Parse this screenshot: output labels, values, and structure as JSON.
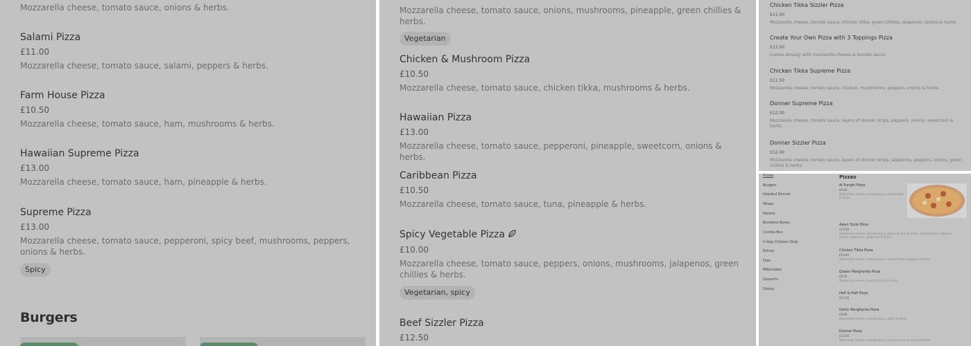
{
  "panel1": {
    "top_desc": "Mozzarella cheese, tomato sauce, onions & herbs.",
    "items": [
      {
        "name": "Salami Pizza",
        "price": "£11.00",
        "desc": "Mozzarella cheese, tomato sauce, salami, peppers & herbs."
      },
      {
        "name": "Farm House Pizza",
        "price": "£10.50",
        "desc": "Mozzarella cheese, tomato sauce, ham, mushrooms & herbs."
      },
      {
        "name": "Hawaiian Supreme Pizza",
        "price": "£13.00",
        "desc": "Mozzarella cheese, tomato sauce, ham, pineapple & herbs."
      },
      {
        "name": "Supreme Pizza",
        "price": "£13.00",
        "desc": "Mozzarella cheese, tomato sauce, pepperoni, spicy beef, mushrooms, peppers, onions & herbs.",
        "tag": "Spicy"
      }
    ],
    "section_heading": "Burgers"
  },
  "panel2": {
    "top_desc": "Mozzarella cheese, tomato sauce, onions, mushrooms, pineapple, green chillies & herbs.",
    "top_tag": "Vegetarian",
    "items": [
      {
        "name": "Chicken & Mushroom Pizza",
        "price": "£10.50",
        "desc": "Mozzarella cheese, tomato sauce, chicken tikka, mushrooms & herbs."
      },
      {
        "name": "Hawaiian Pizza",
        "price": "£13.00",
        "desc": "Mozzarella cheese, tomato sauce, pepperoni, pineapple, sweetcorn, onions & herbs."
      },
      {
        "name": "Caribbean Pizza",
        "price": "£10.50",
        "desc": "Mozzarella cheese, tomato sauce, tuna, pineapple & herbs."
      },
      {
        "name": "Spicy Vegetable Pizza",
        "price": "£10.00",
        "desc": "Mozzarella cheese, tomato sauce, peppers, onions, mushrooms, jalapenos, green chillies & herbs.",
        "tag": "Vegetarian, spicy"
      },
      {
        "name": "Beef Sizzler Pizza",
        "price": "£12.50"
      }
    ]
  },
  "panel3": {
    "items": [
      {
        "name": "Chicken Tikka Sizzler Pizza",
        "price": "£11.00",
        "desc": "Mozzarella cheese, tomato sauce, chicken tikka, green chillies, jalapenos, onions & herbs."
      },
      {
        "name": "Create Your Own Pizza with 3 Toppings Pizza",
        "price": "£13.50",
        "desc": "Comes already with mozzarella cheese & tomato sauce"
      },
      {
        "name": "Chicken Tikka Supreme Pizza",
        "price": "£11.50",
        "desc": "Mozzarella cheese, tomato sauce, chicken, mushrooms, peppers, onions & herbs."
      },
      {
        "name": "Donner Supreme Pizza",
        "price": "£12.00",
        "desc": "Mozzarella cheese, tomato sauce, layers of donner strips, peppers, onions, sweetcorn & herbs."
      },
      {
        "name": "Donner Sizzler Pizza",
        "price": "£12.00",
        "desc": "Mozzarella cheese, tomato sauce, layers of donner strips, jalapenos, peppers, onions, green chillies & herbs."
      }
    ]
  },
  "panel4": {
    "nav": [
      "Pizzas",
      "Burgers",
      "Istanbul Donner",
      "Wraps",
      "Paninis",
      "Boneless Boxes",
      "Combo Box",
      "Crispy Chicken Strip",
      "Extras",
      "Dips",
      "Milkshakes",
      "Desserts",
      "Drinks"
    ],
    "heading": "Pizzas",
    "items": [
      {
        "name": "Al Funghi Pizza",
        "price": "£9.00",
        "desc": "Mozzarella cheese, tomato sauce, mushrooms & herbs."
      },
      {
        "name": "Asian Style Pizza",
        "price": "£12.00",
        "desc": "Mozzarella cheese, tomato sauce, layers of donner strips, chicken tikka, peppers, onions, sweetcorn, jalapenos & herbs."
      },
      {
        "name": "Chicken Tikka Pizza",
        "price": "£10.00",
        "desc": "Mozzarella cheese, tomato sauce, chicken tikka, peppers & herbs."
      },
      {
        "name": "Queen Margherita Pizza",
        "price": "£8.50",
        "desc": "Mozzarella cheese, tomato sauce & herbs."
      },
      {
        "name": "Half & Half Pizza",
        "price": "£12.50"
      },
      {
        "name": "Garlic Margherita Pizza",
        "price": "£9.00",
        "desc": "Mozzarella cheese, tomato sauce, garlic & herbs."
      },
      {
        "name": "Donner Pizza",
        "price": "£11.00",
        "desc": "Mozzarella cheese, tomato sauce, layers of donner strips & herbs."
      }
    ]
  },
  "colors": {
    "overlay": "#c2c2c2",
    "tag_bg": "#b3b3b3",
    "badge_green": "#5c8a6a",
    "leaf": "#333333"
  }
}
